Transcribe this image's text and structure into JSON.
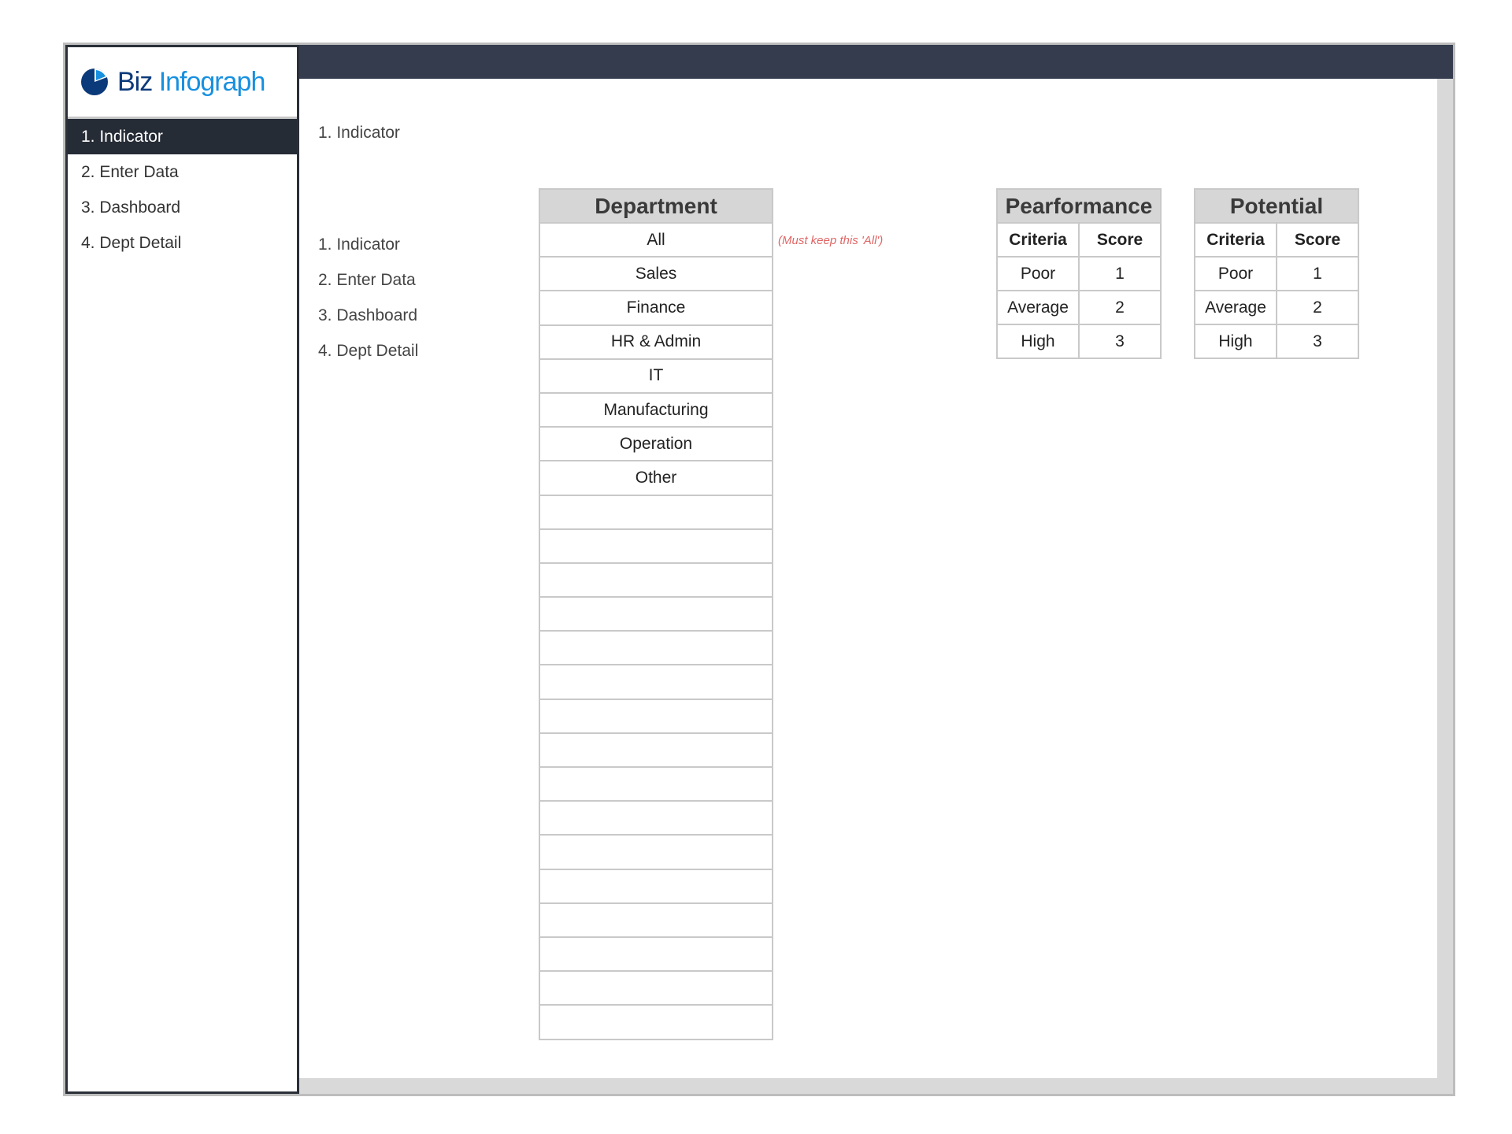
{
  "brand": {
    "name_part1": "Biz",
    "name_part2": "Infograph",
    "colors": {
      "dark_blue": "#0b3a7a",
      "light_blue": "#1790e0"
    }
  },
  "sidebar": {
    "items": [
      {
        "label": "1. Indicator",
        "active": true
      },
      {
        "label": "2. Enter Data",
        "active": false
      },
      {
        "label": "3. Dashboard",
        "active": false
      },
      {
        "label": "4. Dept Detail",
        "active": false
      }
    ]
  },
  "main": {
    "title": "1. Indicator",
    "links": [
      "1. Indicator",
      "2. Enter Data",
      "3. Dashboard",
      "4. Dept Detail"
    ]
  },
  "department": {
    "header": "Department",
    "rows": [
      "All",
      "Sales",
      "Finance",
      "HR & Admin",
      "IT",
      "Manufacturing",
      "Operation",
      "Other",
      "",
      "",
      "",
      "",
      "",
      "",
      "",
      "",
      "",
      "",
      "",
      "",
      "",
      "",
      "",
      ""
    ],
    "note": "(Must keep this 'All')"
  },
  "performance": {
    "header": "Pearformance",
    "col1": "Criteria",
    "col2": "Score",
    "rows": [
      {
        "criteria": "Poor",
        "score": "1"
      },
      {
        "criteria": "Average",
        "score": "2"
      },
      {
        "criteria": "High",
        "score": "3"
      }
    ]
  },
  "potential": {
    "header": "Potential",
    "col1": "Criteria",
    "col2": "Score",
    "rows": [
      {
        "criteria": "Poor",
        "score": "1"
      },
      {
        "criteria": "Average",
        "score": "2"
      },
      {
        "criteria": "High",
        "score": "3"
      }
    ]
  },
  "colors": {
    "topbar": "#343c4d",
    "sidebar_active": "#262c36",
    "header_bg": "#d6d6d6",
    "note": "#e06666"
  }
}
